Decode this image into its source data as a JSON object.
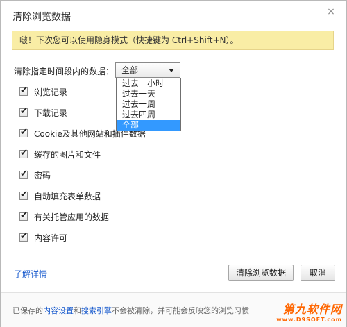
{
  "dialog": {
    "title": "清除浏览数据",
    "close_glyph": "×"
  },
  "banner": {
    "text": "啵！下次您可以使用隐身模式（快捷键为 Ctrl+Shift+N）。"
  },
  "time_range": {
    "label": "清除指定时间段内的数据：",
    "selected": "全部",
    "options": [
      "过去一小时",
      "过去一天",
      "过去一周",
      "过去四周",
      "全部"
    ],
    "selected_index": 4
  },
  "options": [
    {
      "label": "浏览记录",
      "checked": true
    },
    {
      "label": "下载记录",
      "checked": true
    },
    {
      "label": "Cookie及其他网站和插件数据",
      "checked": true
    },
    {
      "label": "缓存的图片和文件",
      "checked": true
    },
    {
      "label": "密码",
      "checked": true
    },
    {
      "label": "自动填充表单数据",
      "checked": true
    },
    {
      "label": "有关托管应用的数据",
      "checked": true
    },
    {
      "label": "内容许可",
      "checked": true
    }
  ],
  "learn_more": "了解详情",
  "buttons": {
    "clear": "清除浏览数据",
    "cancel": "取消"
  },
  "footer": {
    "prefix": "已保存的",
    "link1": "内容设置",
    "middle": "和",
    "link2": "搜索引擎",
    "suffix": "不会被清除，并可能会反映您的浏览习惯"
  },
  "watermark": {
    "brand": "第九软件网",
    "url": "www.D9SOFT.com"
  },
  "icons": {
    "checkmark": "✔",
    "caret": "caret-down-icon",
    "close": "close-icon"
  }
}
